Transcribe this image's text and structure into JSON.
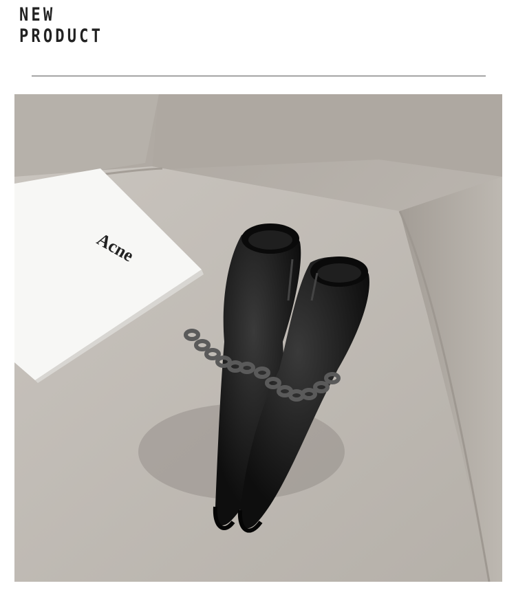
{
  "header": {
    "title_line1": "NEW",
    "title_line2": "PRODUCT"
  },
  "photo": {
    "subject": "black pointed-toe ankle boots with chain strap on a sofa beside a card",
    "card_logo_text": "Acne"
  },
  "colors": {
    "title": "#222222",
    "divider": "#555555",
    "sofa": "#b9b4ae",
    "card": "#f7f7f5",
    "boot": "#151515"
  }
}
